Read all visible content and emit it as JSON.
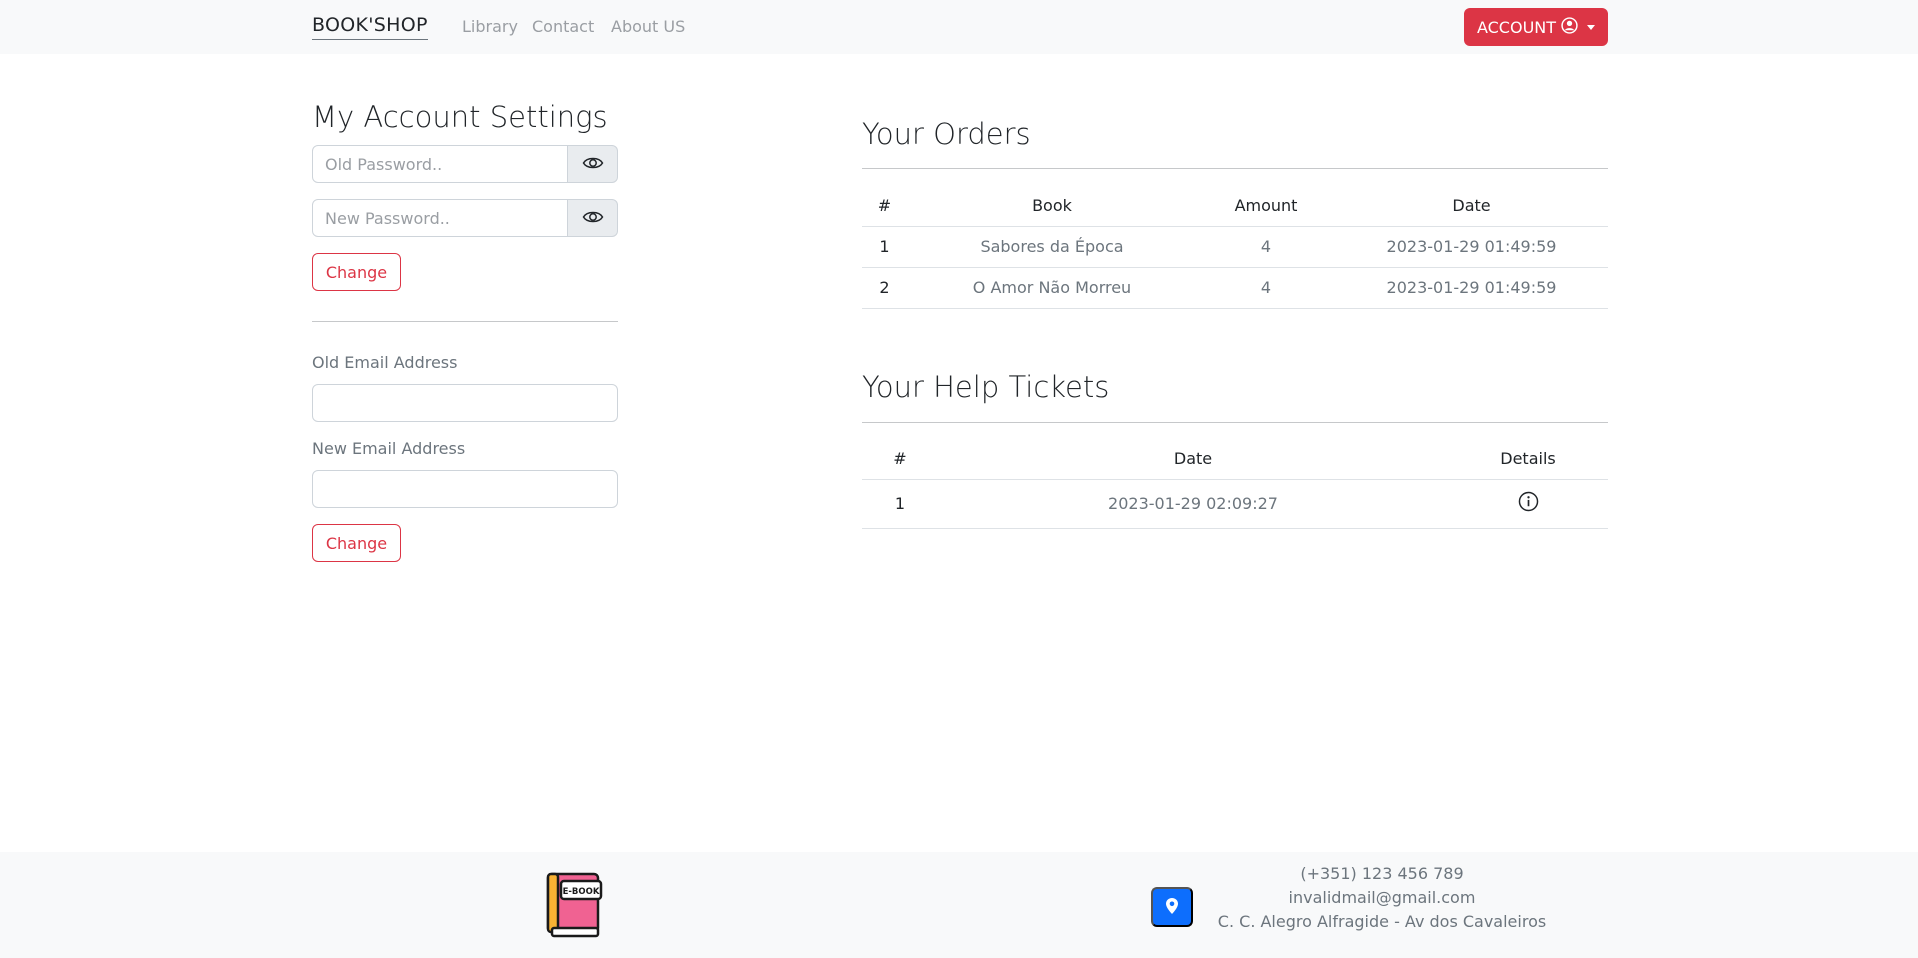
{
  "navbar": {
    "brand": "BOOK'SHOP",
    "links": [
      "Library",
      "Contact",
      "About US"
    ],
    "account_label": "ACCOUNT"
  },
  "settings": {
    "title": "My Account Settings",
    "old_password_placeholder": "Old Password..",
    "new_password_placeholder": "New Password..",
    "change_password_label": "Change",
    "old_email_label": "Old Email Address",
    "new_email_label": "New Email Address",
    "change_email_label": "Change"
  },
  "orders": {
    "title": "Your Orders",
    "headers": [
      "#",
      "Book",
      "Amount",
      "Date"
    ],
    "rows": [
      [
        "1",
        "Sabores da Época",
        "4",
        "2023-01-29 01:49:59"
      ],
      [
        "2",
        "O Amor Não Morreu",
        "4",
        "2023-01-29 01:49:59"
      ]
    ]
  },
  "tickets": {
    "title": "Your Help Tickets",
    "headers": [
      "#",
      "Date",
      "Details"
    ],
    "rows": [
      [
        "1",
        "2023-01-29 02:09:27"
      ]
    ]
  },
  "footer": {
    "logo_text": "E-BOOK",
    "phone": "(+351) 123 456 789",
    "email": "invalidmail@gmail.com",
    "address": "C. C. Alegro Alfragide - Av dos Cavaleiros"
  },
  "colors": {
    "danger": "#dc3545",
    "primary": "#0d6efd",
    "light_bg": "#f8f9fa"
  }
}
